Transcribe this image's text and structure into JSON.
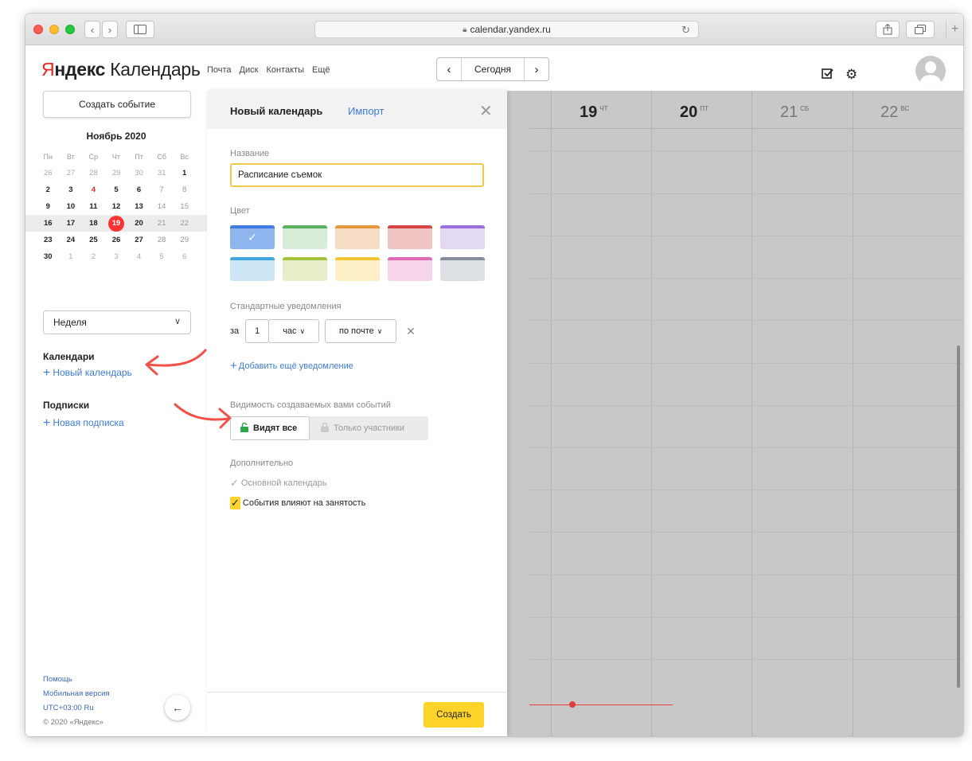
{
  "browser": {
    "url": "calendar.yandex.ru",
    "back": "‹",
    "forward": "›"
  },
  "header": {
    "logo_first": "Я",
    "logo_rest": "ндекс",
    "logo_product": "Календарь",
    "nav": [
      "Почта",
      "Диск",
      "Контакты",
      "Ещё"
    ],
    "date_nav": {
      "prev": "‹",
      "today": "Сегодня",
      "next": "›"
    }
  },
  "sidebar": {
    "create_button": "Создать событие",
    "month_title": "Ноябрь 2020",
    "weekdays": [
      "Пн",
      "Вт",
      "Ср",
      "Чт",
      "Пт",
      "Сб",
      "Вс"
    ],
    "weeks": [
      [
        "26",
        "27",
        "28",
        "29",
        "30",
        "31",
        "1"
      ],
      [
        "2",
        "3",
        "4",
        "5",
        "6",
        "7",
        "8"
      ],
      [
        "9",
        "10",
        "11",
        "12",
        "13",
        "14",
        "15"
      ],
      [
        "16",
        "17",
        "18",
        "19",
        "20",
        "21",
        "22"
      ],
      [
        "23",
        "24",
        "25",
        "26",
        "27",
        "28",
        "29"
      ],
      [
        "30",
        "1",
        "2",
        "3",
        "4",
        "5",
        "6"
      ]
    ],
    "today": "19",
    "view_select": "Неделя",
    "calendars_title": "Календари",
    "new_calendar": "Новый календарь",
    "subscriptions_title": "Подписки",
    "new_subscription": "Новая подписка",
    "help": "Помощь",
    "mobile": "Мобильная версия",
    "tz_lang": "UTC+03:00  Ru",
    "copyright": "© 2020 «Яндекс»"
  },
  "week_days": [
    {
      "num": "19",
      "dow": "ЧТ"
    },
    {
      "num": "20",
      "dow": "ПТ"
    },
    {
      "num": "21",
      "dow": "СБ"
    },
    {
      "num": "22",
      "dow": "ВС"
    }
  ],
  "panel": {
    "title": "Новый календарь",
    "import": "Импорт",
    "name_label": "Название",
    "name_value": "Расписание съемок",
    "color_label": "Цвет",
    "colors": [
      {
        "bg": "#8fb5ee",
        "top": "#3f7be0",
        "selected": true
      },
      {
        "bg": "#d6ecd6",
        "top": "#59b25f",
        "selected": false
      },
      {
        "bg": "#f6dcc4",
        "top": "#e8963a",
        "selected": false
      },
      {
        "bg": "#f1c4c4",
        "top": "#d64545",
        "selected": false
      },
      {
        "bg": "#e3d9f5",
        "top": "#9a6fdf",
        "selected": false
      },
      {
        "bg": "#cde6f6",
        "top": "#3fa6e0",
        "selected": false
      },
      {
        "bg": "#e6efc9",
        "top": "#a3c33b",
        "selected": false
      },
      {
        "bg": "#fcefc5",
        "top": "#f2c335",
        "selected": false
      },
      {
        "bg": "#f6d4e9",
        "top": "#e06ab8",
        "selected": false
      },
      {
        "bg": "#dcdfe3",
        "top": "#848d98",
        "selected": false
      }
    ],
    "notif_label": "Стандартные уведомления",
    "notif_prefix": "за",
    "notif_amount": "1",
    "notif_unit": "час",
    "notif_channel": "по почте",
    "add_notif": "Добавить ещё уведомление",
    "visibility_label": "Видимость создаваемых вами событий",
    "vis_all": "Видят все",
    "vis_participants": "Только участники",
    "extra_label": "Дополнительно",
    "main_calendar": "Основной календарь",
    "busy": "События влияют на занятость",
    "submit": "Создать"
  },
  "colors": {
    "accent_red": "#e4271f",
    "link_blue": "#3d7bd9",
    "submit_yellow": "#fed42b",
    "annotation": "#f0524a"
  }
}
